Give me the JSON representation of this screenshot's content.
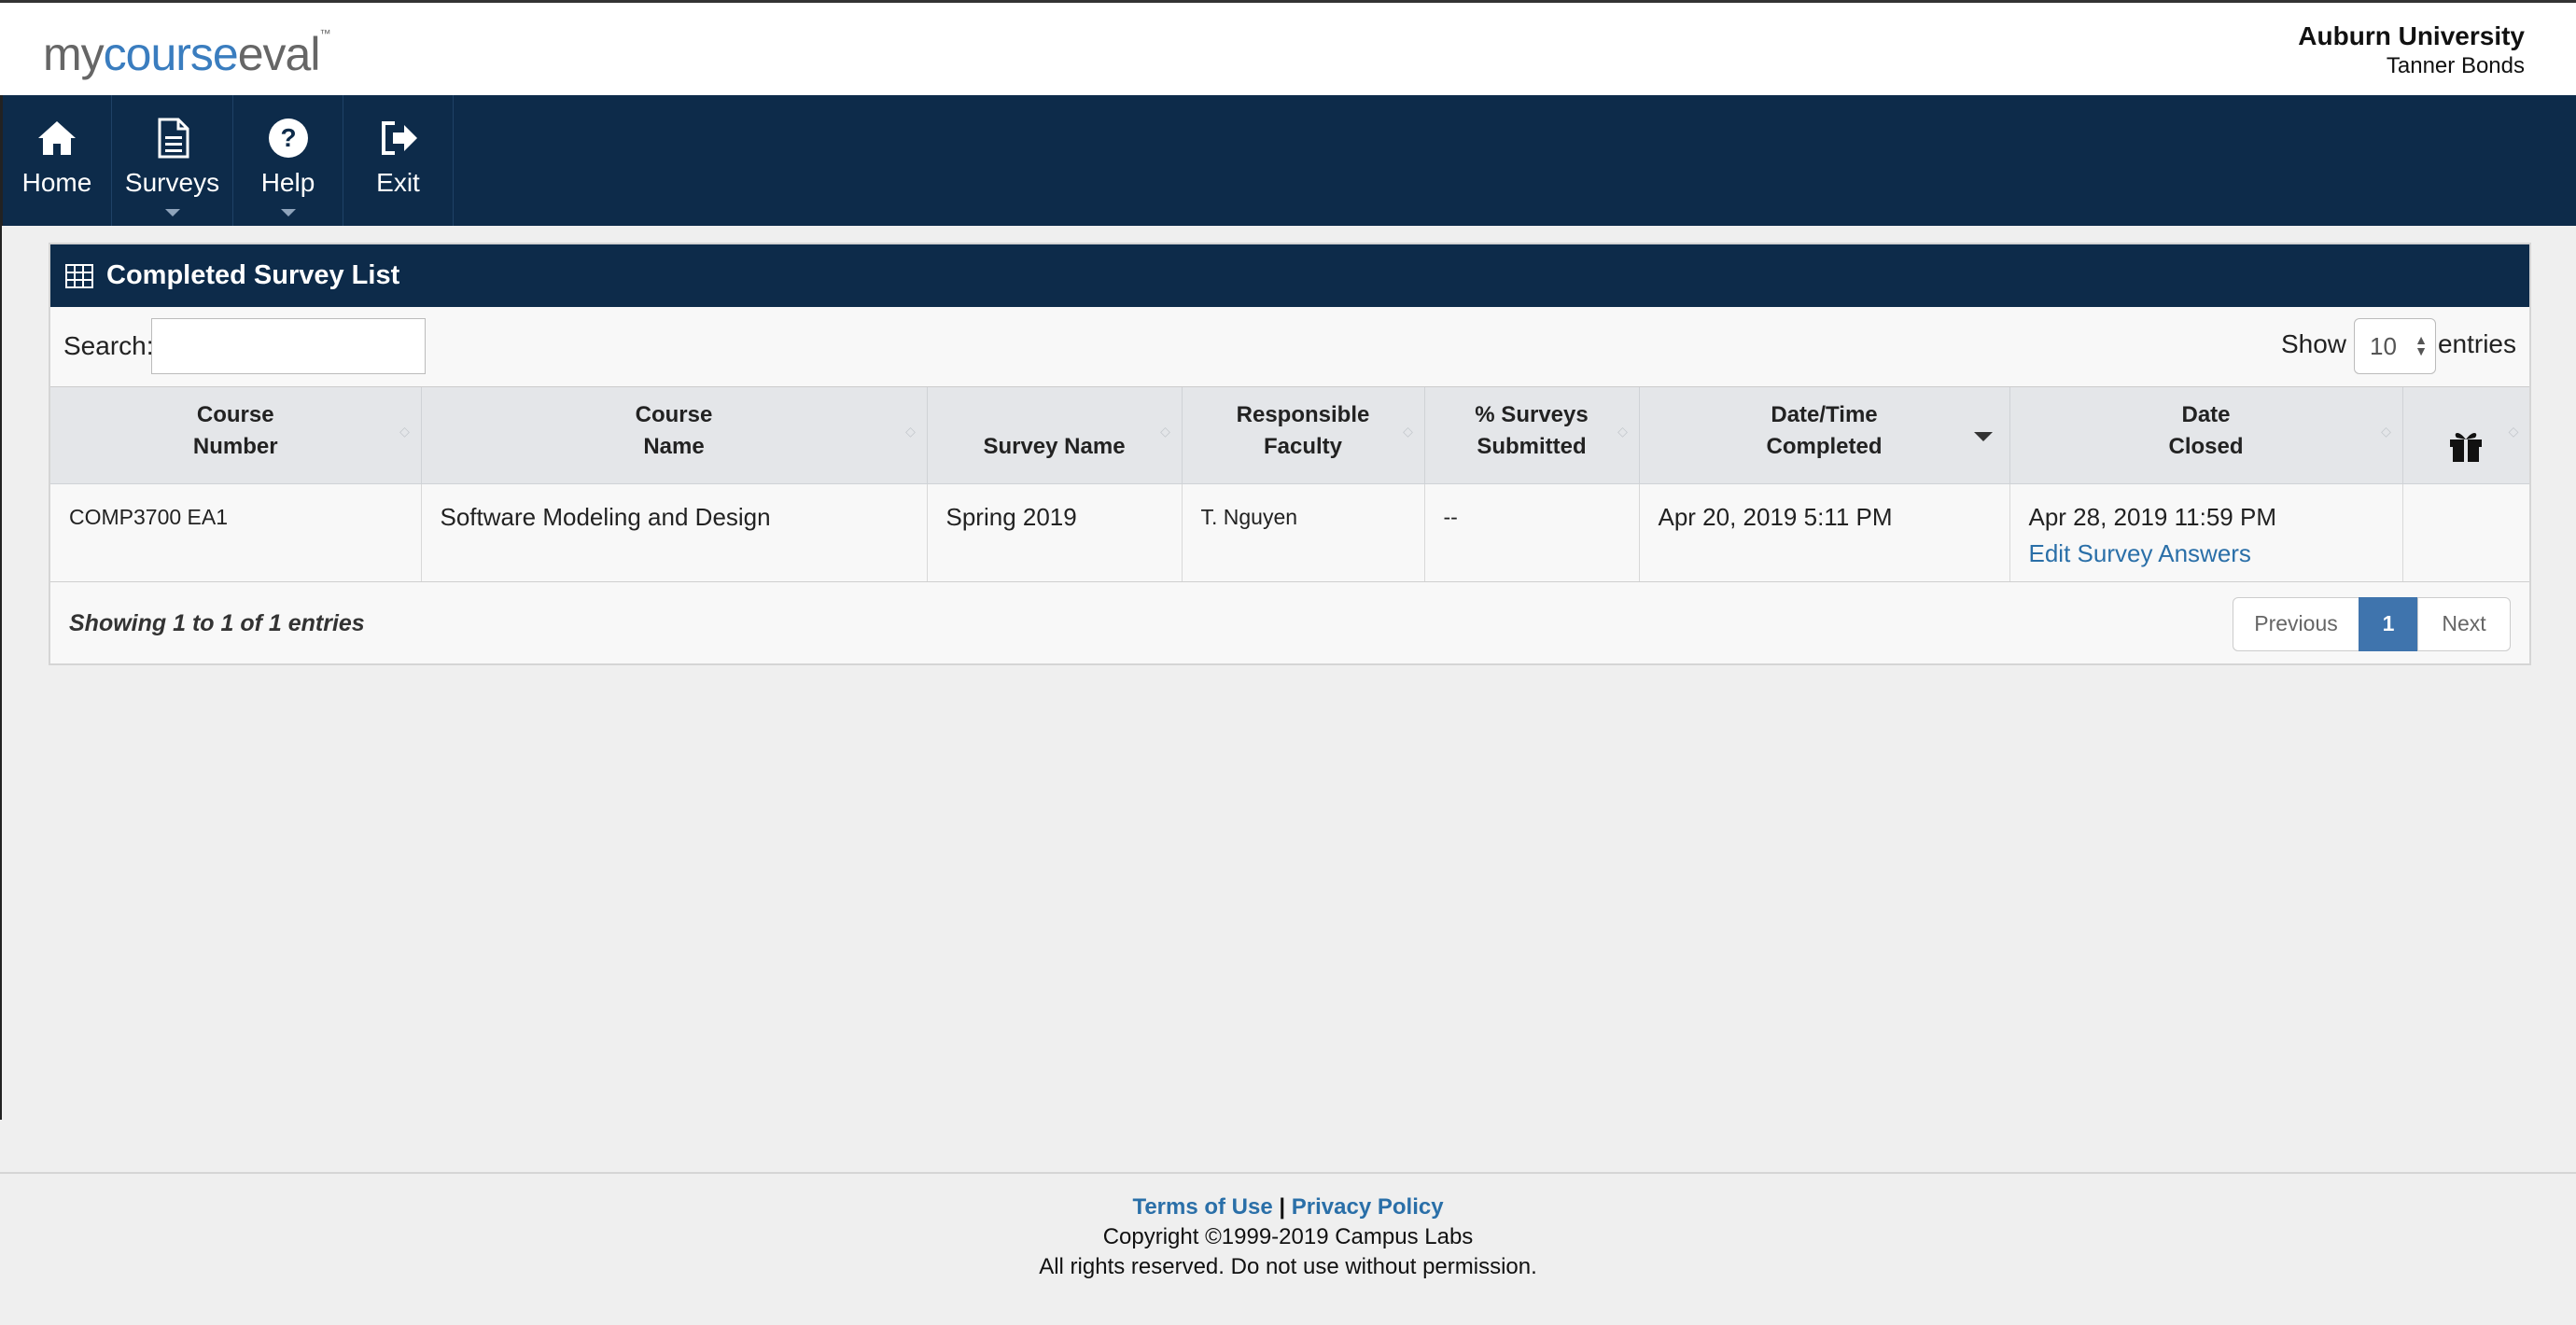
{
  "header": {
    "logo": {
      "my": "my",
      "course": "course",
      "eval": "eval",
      "tm": "™"
    },
    "institution": "Auburn University",
    "user": "Tanner Bonds"
  },
  "nav": {
    "items": [
      {
        "label": "Home",
        "icon": "home-icon"
      },
      {
        "label": "Surveys",
        "icon": "document-icon",
        "dropdown": true
      },
      {
        "label": "Help",
        "icon": "help-circle-icon",
        "dropdown": true
      },
      {
        "label": "Exit",
        "icon": "sign-out-icon"
      }
    ]
  },
  "panel": {
    "title": "Completed Survey List",
    "search_label": "Search:",
    "search_value": "",
    "show_label": "Show",
    "page_length": "10",
    "entries_label": "entries",
    "columns": [
      [
        "Course",
        "Number"
      ],
      [
        "Course",
        "Name"
      ],
      [
        "Survey Name"
      ],
      [
        "Responsible",
        "Faculty"
      ],
      [
        "% Surveys",
        "Submitted"
      ],
      [
        "Date/Time",
        "Completed"
      ],
      [
        "Date",
        "Closed"
      ]
    ],
    "rows": [
      {
        "course_number": "COMP3700 EA1",
        "course_name": "Software Modeling and Design",
        "survey_name": "Spring 2019",
        "faculty": "T. Nguyen",
        "percent_submitted": "--",
        "completed": "Apr 20, 2019 5:11 PM",
        "closed": "Apr 28, 2019 11:59 PM",
        "action": "Edit Survey Answers"
      }
    ],
    "info": "Showing 1 to 1 of 1 entries",
    "pager": {
      "previous": "Previous",
      "current": "1",
      "next": "Next"
    }
  },
  "footer": {
    "terms": "Terms of Use",
    "separator": "|",
    "privacy": "Privacy Policy",
    "copyright": "Copyright ©1999-2019 Campus Labs",
    "rights": "All rights reserved. Do not use without permission."
  },
  "colors": {
    "navbar": "#0d2b4a",
    "link": "#2a6fa8",
    "pager_active": "#3f74ad"
  }
}
